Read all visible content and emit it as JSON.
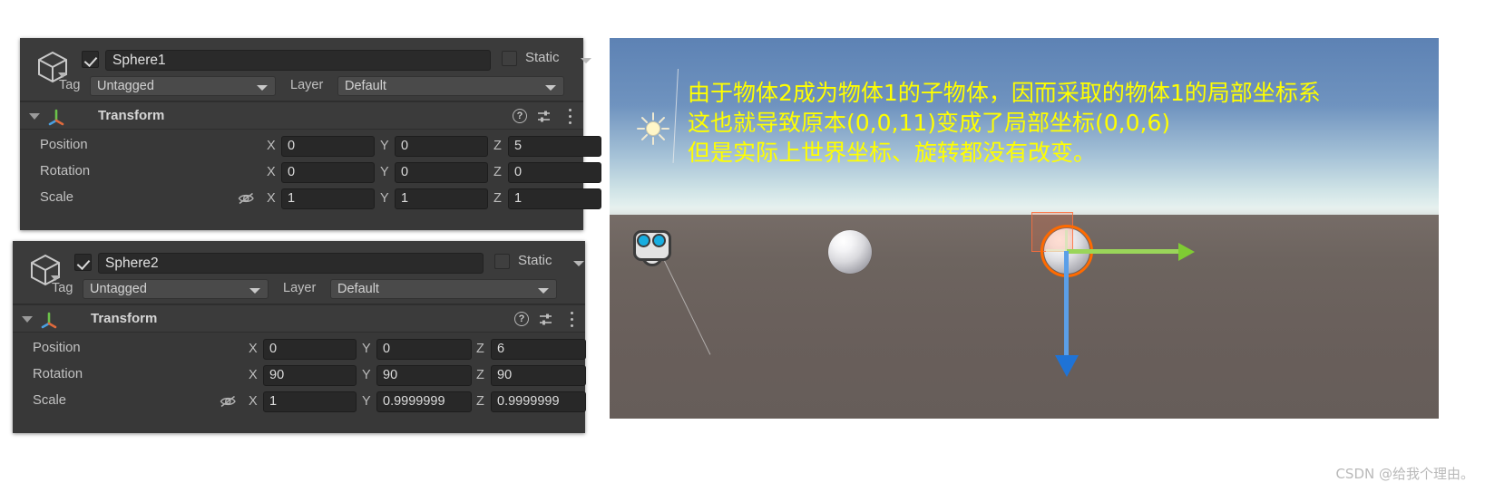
{
  "inspectors": [
    {
      "object_name": "Sphere1",
      "enabled": true,
      "static_label": "Static",
      "static_checked": false,
      "tag_label": "Tag",
      "tag_value": "Untagged",
      "layer_label": "Layer",
      "layer_value": "Default",
      "component": {
        "title": "Transform",
        "rows": [
          {
            "label": "Position",
            "x": "0",
            "y": "0",
            "z": "5"
          },
          {
            "label": "Rotation",
            "x": "0",
            "y": "0",
            "z": "0"
          },
          {
            "label": "Scale",
            "x": "1",
            "y": "1",
            "z": "1"
          }
        ],
        "axis_labels": {
          "x": "X",
          "y": "Y",
          "z": "Z"
        }
      }
    },
    {
      "object_name": "Sphere2",
      "enabled": true,
      "static_label": "Static",
      "static_checked": false,
      "tag_label": "Tag",
      "tag_value": "Untagged",
      "layer_label": "Layer",
      "layer_value": "Default",
      "component": {
        "title": "Transform",
        "rows": [
          {
            "label": "Position",
            "x": "0",
            "y": "0",
            "z": "6"
          },
          {
            "label": "Rotation",
            "x": "90",
            "y": "90",
            "z": "90"
          },
          {
            "label": "Scale",
            "x": "1",
            "y": "0.9999999",
            "z": "0.9999999"
          }
        ],
        "axis_labels": {
          "x": "X",
          "y": "Y",
          "z": "Z"
        }
      }
    }
  ],
  "scene": {
    "annotation": {
      "color": "#ffff00",
      "lines": [
        "由于物体2成为物体1的子物体，因而采取的物体1的局部坐标系",
        "这也就导致原本(0,0,11)变成了局部坐标(0,0,6)",
        "但是实际上世界坐标、旋转都没有改变。"
      ]
    },
    "gizmo_colors": {
      "selection_outline": "#ff6a00",
      "x_axis": "#ff6e3c",
      "y_axis": "#9ad55a",
      "z_axis": "#5b9fe8"
    },
    "sky_color": "#6f93bf",
    "ground_color": "#6b625e"
  },
  "watermark": "CSDN @给我个理由。"
}
